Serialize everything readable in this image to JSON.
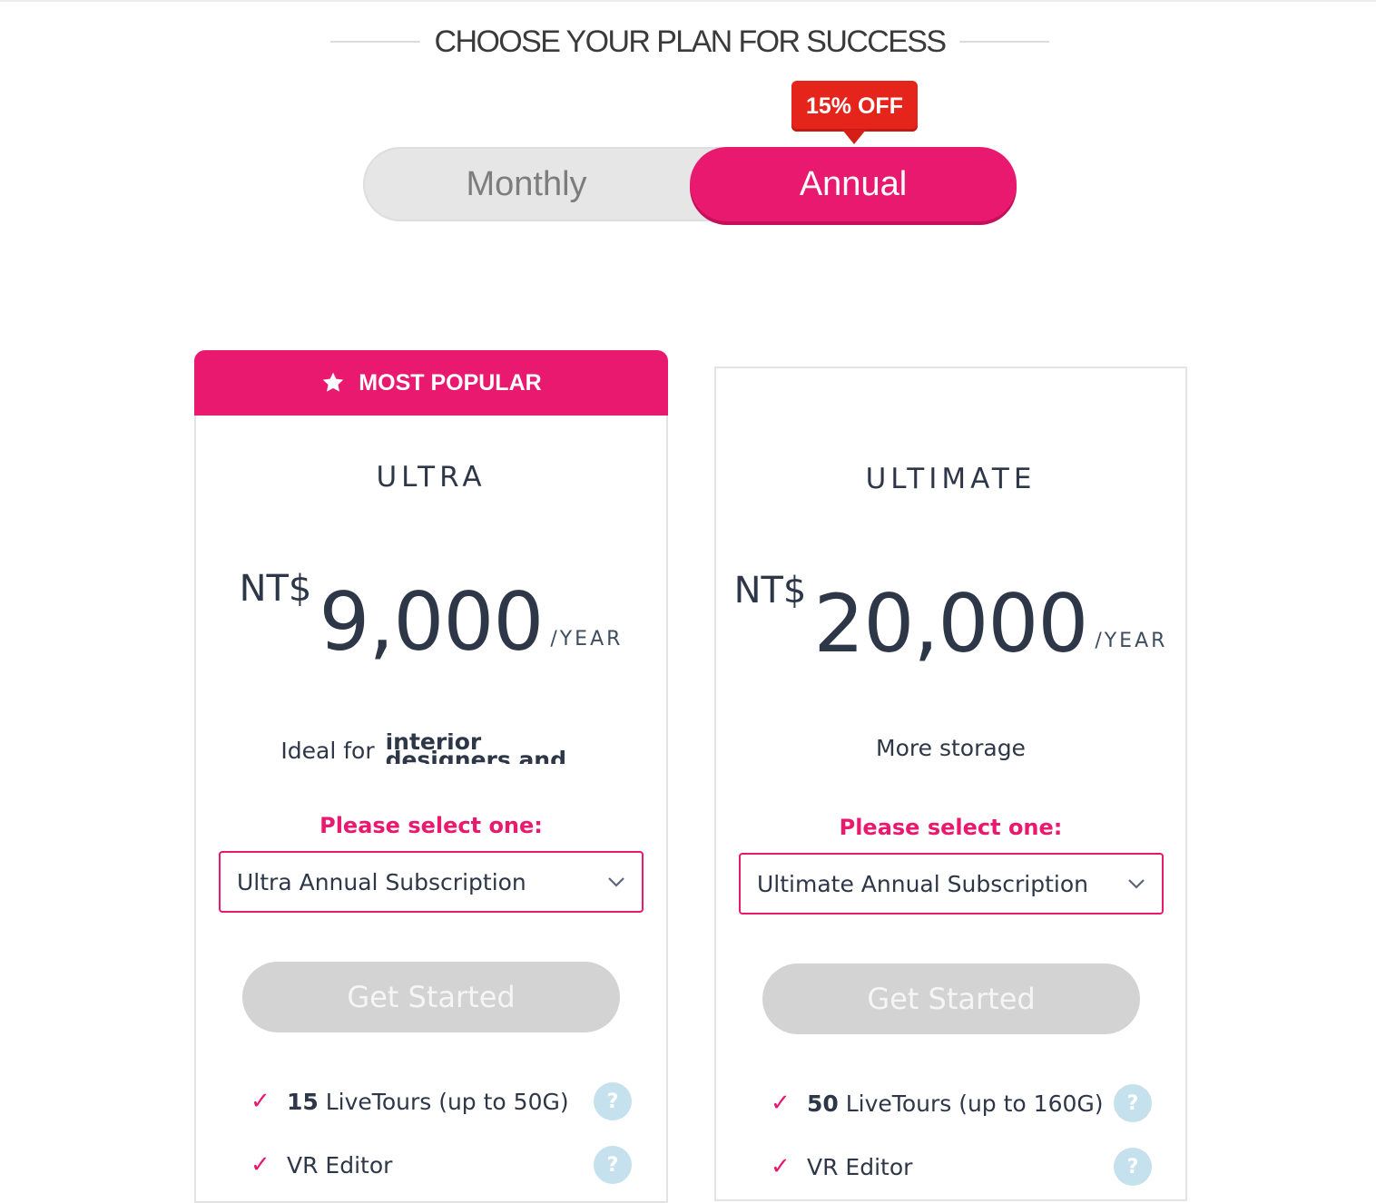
{
  "heading": "CHOOSE YOUR PLAN FOR SUCCESS",
  "billing": {
    "monthly_label": "Monthly",
    "annual_label": "Annual",
    "selected": "Annual",
    "discount_badge": "15% OFF"
  },
  "colors": {
    "accent": "#e8196f",
    "badge_red": "#e5251b",
    "button_disabled": "#d3d3d3",
    "help_icon": "#c5e1ee",
    "text_dark": "#2d3748"
  },
  "plans": [
    {
      "badge": "MOST POPULAR",
      "badge_icon": "star-icon",
      "name": "ULTRA",
      "currency": "NT$",
      "amount": "9,000",
      "period": "/YEAR",
      "desc_prefix": "Ideal for",
      "desc_emphasis": "interior designers and real estate agents",
      "select_label": "Please select one:",
      "select_value": "Ultra Annual Subscription",
      "cta": "Get Started",
      "features": [
        {
          "bold": "15",
          "text": " LiveTours (up to 50G)",
          "help": "?"
        },
        {
          "bold": "",
          "text": "VR Editor",
          "help": "?"
        }
      ]
    },
    {
      "name": "ULTIMATE",
      "currency": "NT$",
      "amount": "20,000",
      "period": "/YEAR",
      "desc": "More storage",
      "select_label": "Please select one:",
      "select_value": "Ultimate Annual Subscription",
      "cta": "Get Started",
      "features": [
        {
          "bold": "50",
          "text": " LiveTours (up to 160G)",
          "help": "?"
        },
        {
          "bold": "",
          "text": "VR Editor",
          "help": "?"
        }
      ]
    }
  ]
}
